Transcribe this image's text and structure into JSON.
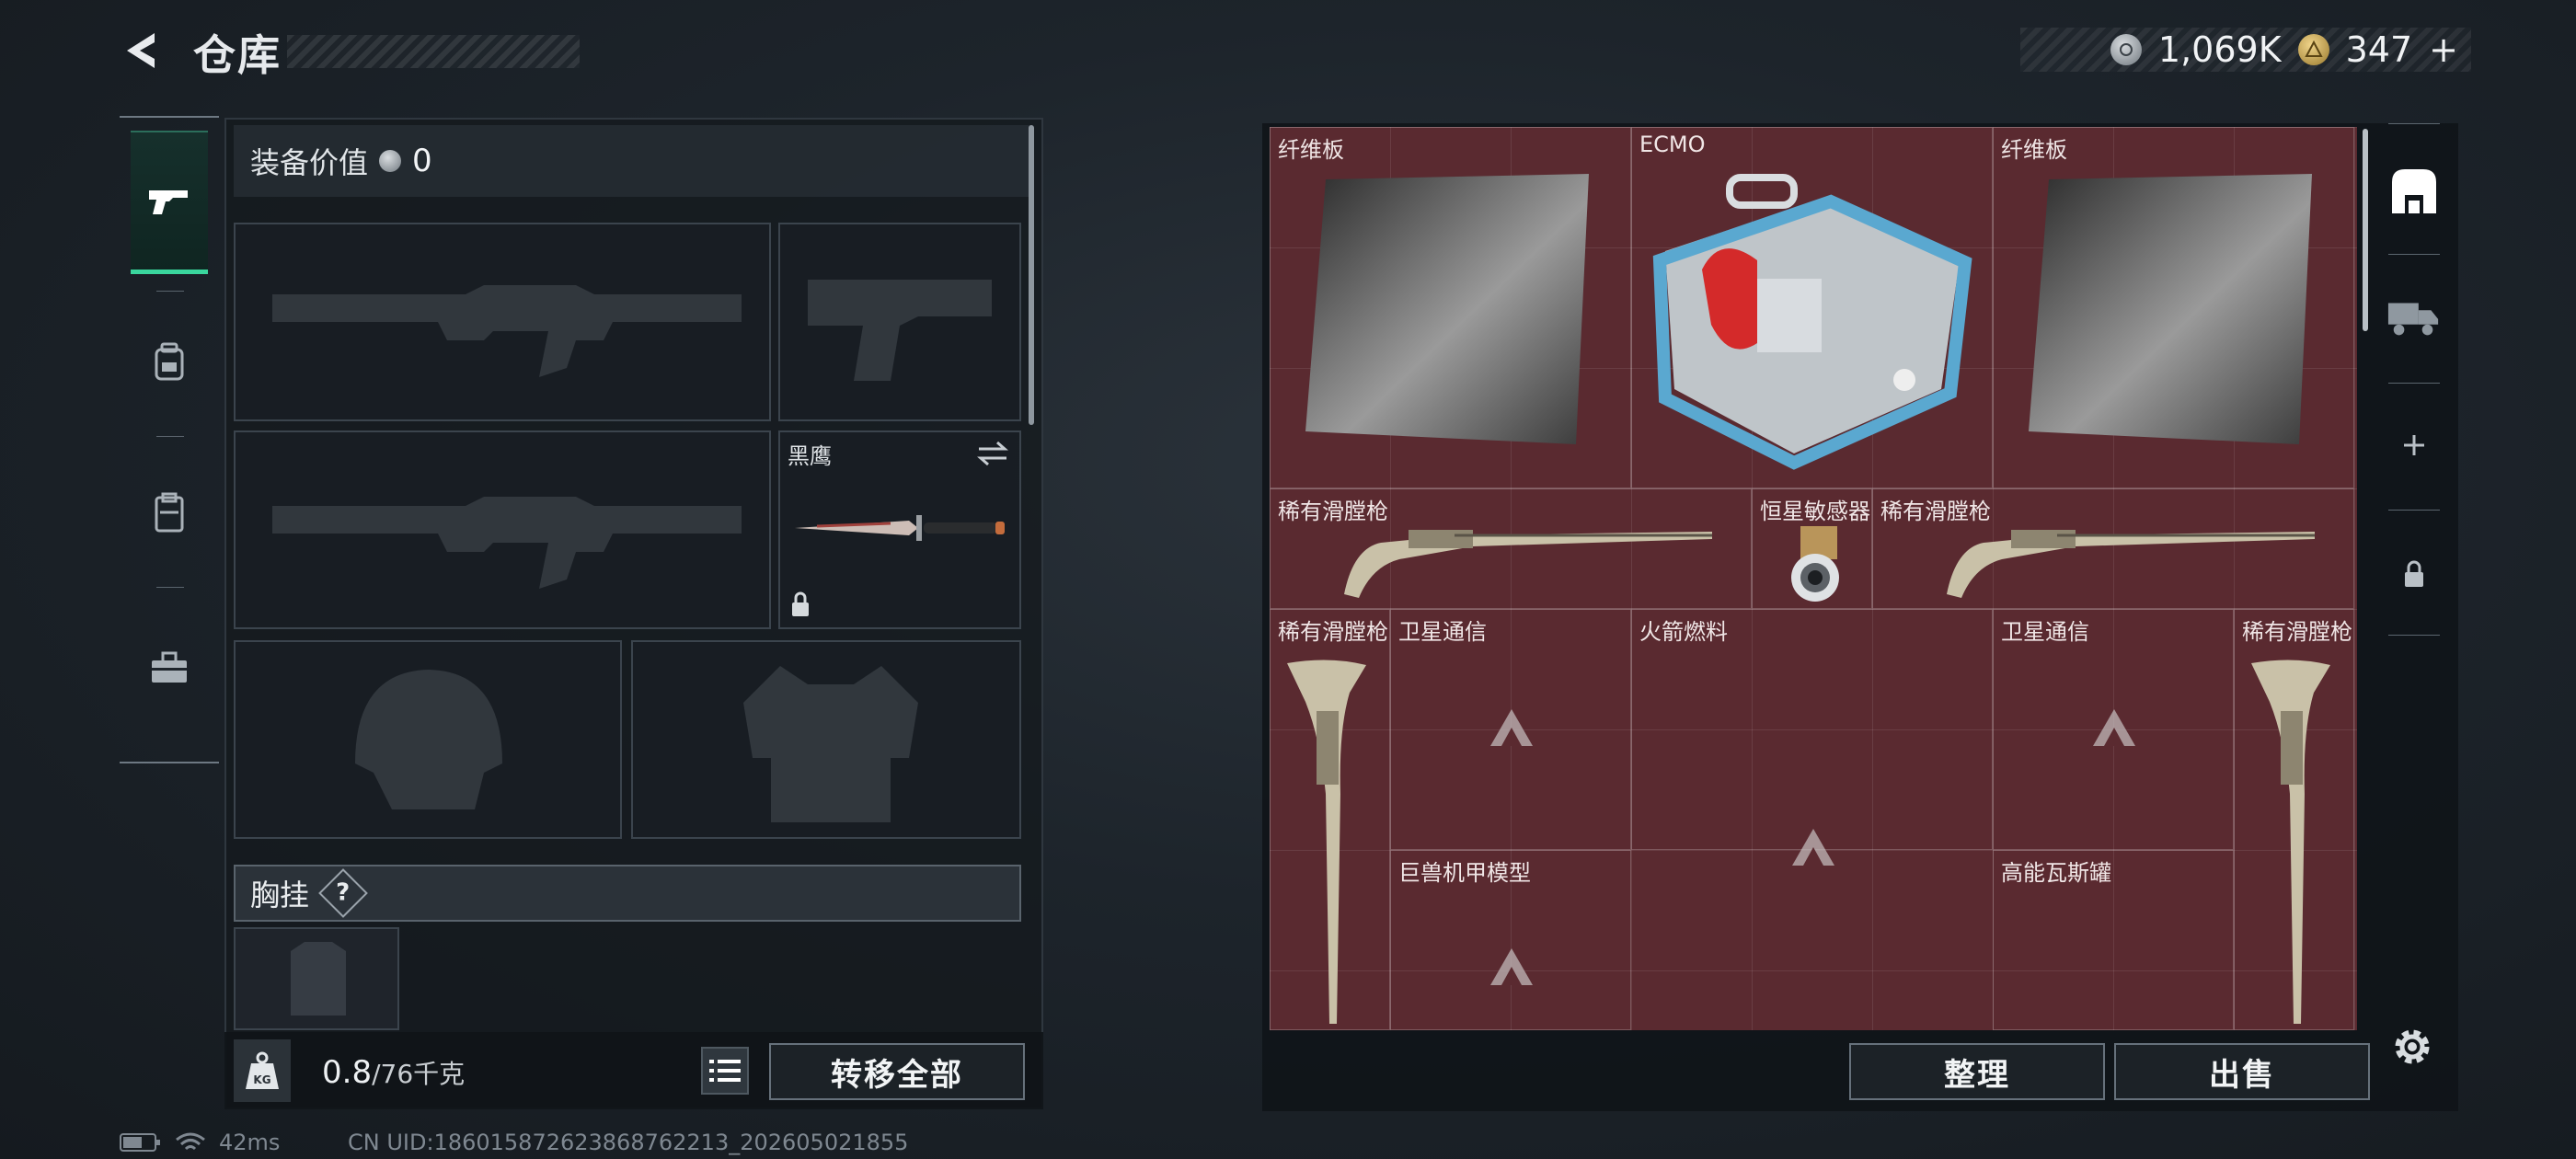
{
  "header": {
    "title": "仓库"
  },
  "currency": {
    "silver": "1,069K",
    "gold": "347",
    "gold_suffix": "+"
  },
  "equipment": {
    "value_label": "装备价值",
    "value": "0",
    "melee_label": "黑鹰",
    "chest_label": "胸挂",
    "chest_help": "?"
  },
  "weight": {
    "current": "0.8",
    "max": "/76千克",
    "icon_text": "KG"
  },
  "buttons": {
    "transfer_all": "转移全部",
    "sort": "整理",
    "sell": "出售"
  },
  "container_items": [
    {
      "name": "纤维板"
    },
    {
      "name": "ECMO"
    },
    {
      "name": "纤维板"
    },
    {
      "name": "稀有滑膛枪"
    },
    {
      "name": "恒星敏感器"
    },
    {
      "name": "稀有滑膛枪"
    },
    {
      "name": "稀有滑膛枪"
    },
    {
      "name": "卫星通信"
    },
    {
      "name": "火箭燃料"
    },
    {
      "name": "卫星通信"
    },
    {
      "name": "稀有滑膛枪"
    },
    {
      "name": "巨兽机甲模型"
    },
    {
      "name": "高能瓦斯罐"
    }
  ],
  "status": {
    "ping": "42ms",
    "uid": "CN UID:1860158726238687622​13_202605021855"
  },
  "colors": {
    "accent": "#3ad69d",
    "grid_bg": "#5a2a30"
  }
}
